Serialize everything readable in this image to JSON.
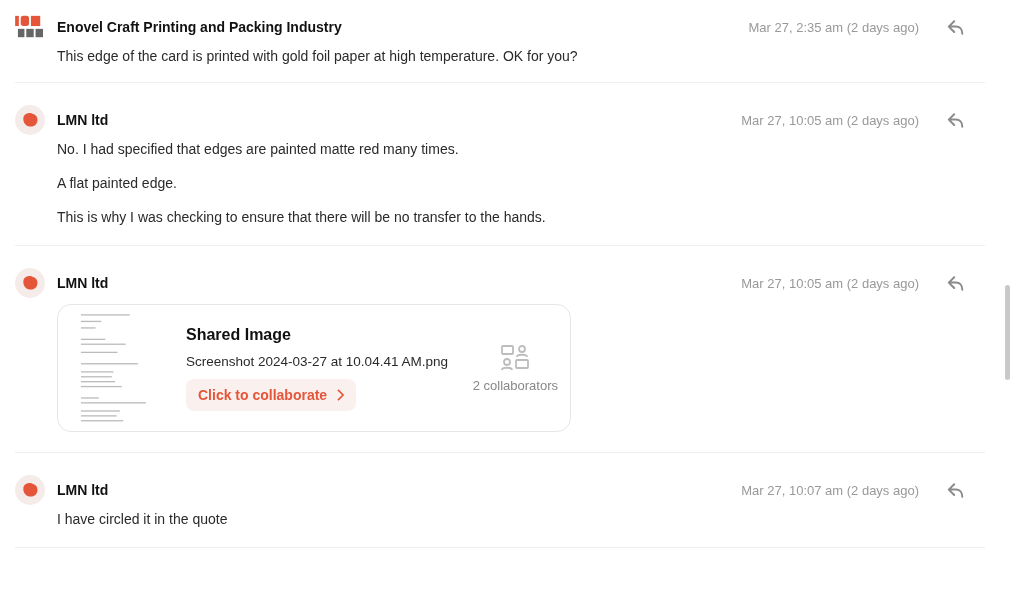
{
  "messages": [
    {
      "author": "Enovel Craft Printing and Packing Industry",
      "kind": "logo",
      "time": "Mar 27, 2:35 am (2 days ago)",
      "paragraphs": [
        "This edge of the card is printed with gold foil paper at high temperature. OK for you?"
      ]
    },
    {
      "author": "LMN ltd",
      "kind": "blob",
      "time": "Mar 27, 10:05 am (2 days ago)",
      "paragraphs": [
        "No. I had specified that edges are painted matte red many times.",
        "A flat painted edge.",
        "This is why I was checking to ensure that there will be no transfer to the hands."
      ]
    },
    {
      "author": "LMN ltd",
      "kind": "blob",
      "time": "Mar 27, 10:05 am (2 days ago)",
      "attachment": {
        "title": "Shared Image",
        "filename": "Screenshot 2024-03-27 at 10.04.41 AM.png",
        "action": "Click to collaborate",
        "collaborators": "2 collaborators"
      }
    },
    {
      "author": "LMN ltd",
      "kind": "blob",
      "time": "Mar 27, 10:07 am (2 days ago)",
      "paragraphs": [
        "I have circled it in the quote"
      ]
    }
  ]
}
